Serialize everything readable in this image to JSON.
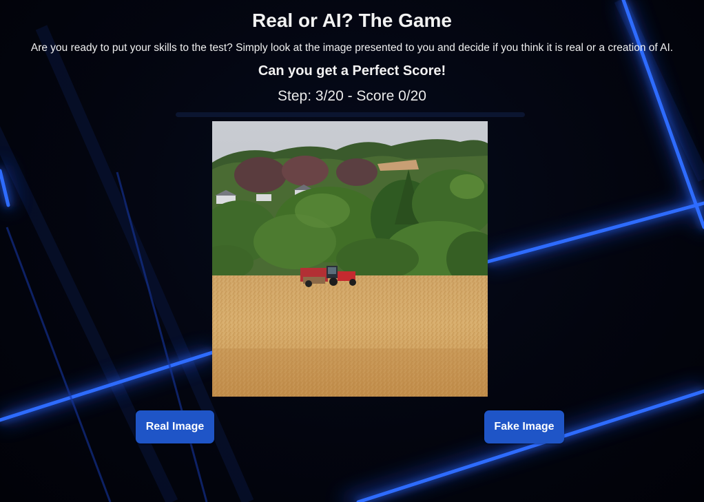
{
  "header": {
    "title": "Real or AI? The Game",
    "subtitle": "Are you ready to put your skills to the test? Simply look at the image presented to you and decide if you think it is real or a creation of AI.",
    "tagline": "Can you get a Perfect Score!"
  },
  "progress": {
    "label": "Step: 3/20 - Score 0/20",
    "step": 3,
    "total_steps": 20,
    "score": 0,
    "fill_fraction": 0.0
  },
  "image": {
    "alt": "Tractor in a golden wheat field with trees and houses on a hillside"
  },
  "buttons": {
    "real_label": "Real Image",
    "fake_label": "Fake Image"
  },
  "colors": {
    "background": "#02040d",
    "accent_line": "#2f6cff",
    "button": "#1f55c7",
    "progress_track": "#0b1530"
  }
}
